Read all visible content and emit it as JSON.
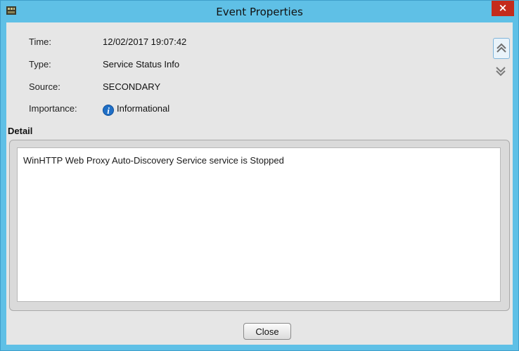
{
  "window": {
    "title": "Event Properties",
    "close_glyph": "×",
    "icon": "app-icon"
  },
  "fields": [
    {
      "label": "Time:",
      "value": "12/02/2017 19:07:42"
    },
    {
      "label": "Type:",
      "value": "Service Status Info"
    },
    {
      "label": "Source:",
      "value": "SECONDARY"
    },
    {
      "label": "Importance:",
      "value": "Informational",
      "icon": "info-icon"
    }
  ],
  "detail": {
    "label": "Detail",
    "text": "WinHTTP Web Proxy Auto-Discovery Service service is Stopped"
  },
  "nav": {
    "up_icon": "chevron-double-up-icon",
    "down_icon": "chevron-double-down-icon"
  },
  "buttons": {
    "close_label": "Close"
  },
  "colors": {
    "titlebar": "#5fc0e6",
    "content_bg": "#e6e6e6",
    "close_red": "#c42b1c",
    "info_blue": "#1f6fc6"
  }
}
